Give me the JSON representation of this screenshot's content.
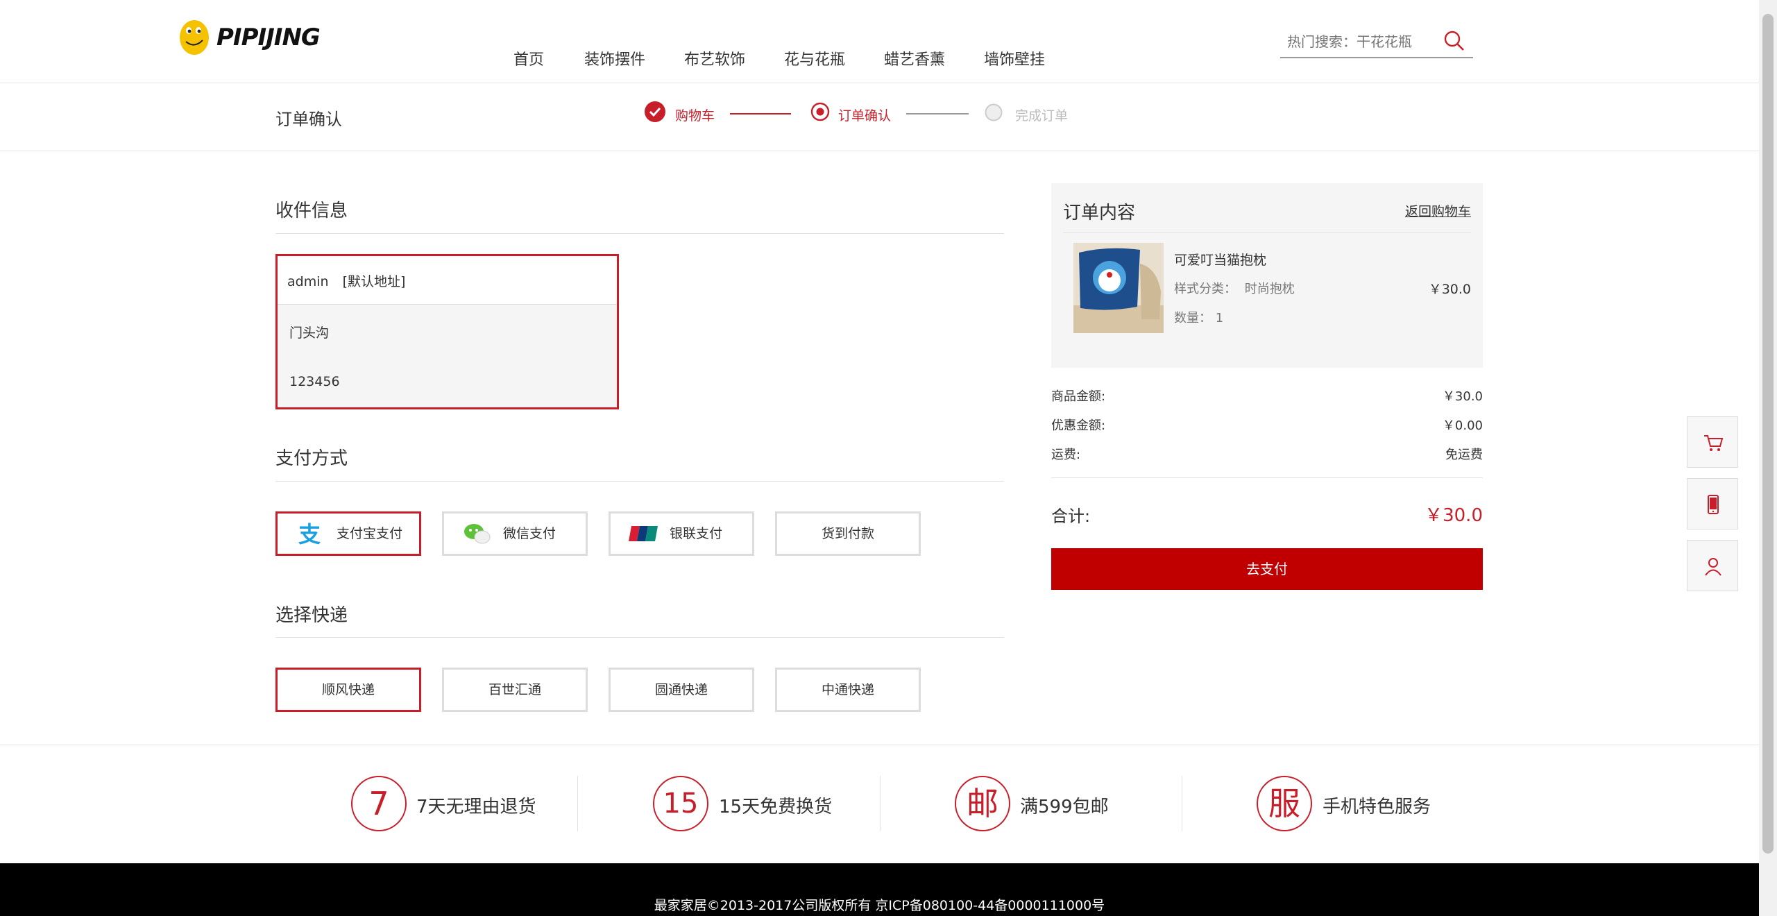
{
  "brand": {
    "logo_text": "PIPIJING"
  },
  "nav": {
    "items": [
      "首页",
      "装饰摆件",
      "布艺软饰",
      "花与花瓶",
      "蜡艺香薰",
      "墙饰壁挂"
    ]
  },
  "search": {
    "placeholder": "热门搜索：干花花瓶"
  },
  "order_bar": {
    "title": "订单确认",
    "steps": [
      {
        "label": "购物车",
        "state": "done"
      },
      {
        "label": "订单确认",
        "state": "current"
      },
      {
        "label": "完成订单",
        "state": "todo"
      }
    ]
  },
  "shipping_info": {
    "title": "收件信息",
    "name": "admin",
    "default_tag": "[默认地址]",
    "address": "门头沟",
    "phone": "123456"
  },
  "payment": {
    "title": "支付方式",
    "options": [
      "支付宝支付",
      "微信支付",
      "银联支付",
      "货到付款"
    ],
    "selected": "支付宝支付"
  },
  "express": {
    "title": "选择快递",
    "options": [
      "顺风快递",
      "百世汇通",
      "圆通快递",
      "中通快递"
    ],
    "selected": "顺风快递"
  },
  "order_summary": {
    "title": "订单内容",
    "back_link": "返回购物车",
    "product": {
      "name": "可爱叮当猫抱枕",
      "style_label": "样式分类：",
      "style_value": "时尚抱枕",
      "qty_label": "数量：",
      "qty_value": "1",
      "price": "￥30.0"
    },
    "goods_amount_label": "商品金额:",
    "goods_amount": "￥30.0",
    "discount_label": "优惠金额:",
    "discount": "￥0.00",
    "shipping_label": "运费:",
    "shipping": "免运费",
    "total_label": "合计:",
    "total": "￥30.0",
    "pay_button": "去支付"
  },
  "services": [
    {
      "glyph": "7",
      "text": "7天无理由退货"
    },
    {
      "glyph": "15",
      "text": "15天免费换货"
    },
    {
      "glyph": "邮",
      "text": "满599包邮"
    },
    {
      "glyph": "服",
      "text": "手机特色服务"
    }
  ],
  "footer": {
    "copyright": "最家家居©2013-2017公司版权所有 京ICP备080100-44备0000111000号"
  },
  "colors": {
    "accent": "#c81e2a",
    "pay_button": "#c00000",
    "footer_bg": "#000000"
  }
}
